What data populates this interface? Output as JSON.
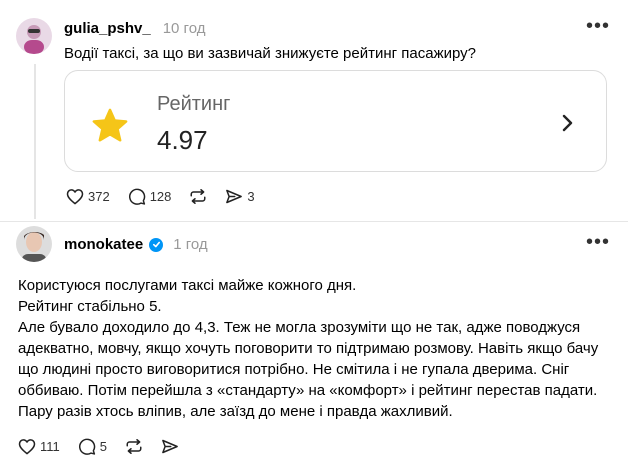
{
  "post1": {
    "username": "gulia_pshv_",
    "time": "10 год",
    "text": "Водії таксі, за що ви зазвичай знижуєте рейтинг пасажиру?",
    "card": {
      "label": "Рейтинг",
      "value": "4.97"
    },
    "actions": {
      "likes": "372",
      "comments": "128",
      "shares": "3"
    }
  },
  "post2": {
    "username": "monokatee",
    "time": "1 год",
    "paragraphs": [
      "Користуюся послугами таксі майже кожного дня.",
      "Рейтинг стабільно 5.",
      "Але бувало доходило до 4,3. Теж не могла зрозуміти що не так, адже поводжуся",
      "адекватно, мовчу, якщо хочуть поговорити то підтримаю розмову. Навіть якщо бачу",
      "що людині просто виговоритися потрібно. Не смітила і не гупала дверима. Сніг",
      "оббиваю. Потім перейшла з «стандарту» на «комфорт» і рейтинг перестав падати.",
      "Пару разів хтось вліпив, але заїзд до мене і правда жахливий."
    ],
    "actions": {
      "likes": "111",
      "comments": "5"
    }
  },
  "colors": {
    "star": "#f5c518",
    "verified": "#0095f6",
    "muted": "#999999"
  }
}
